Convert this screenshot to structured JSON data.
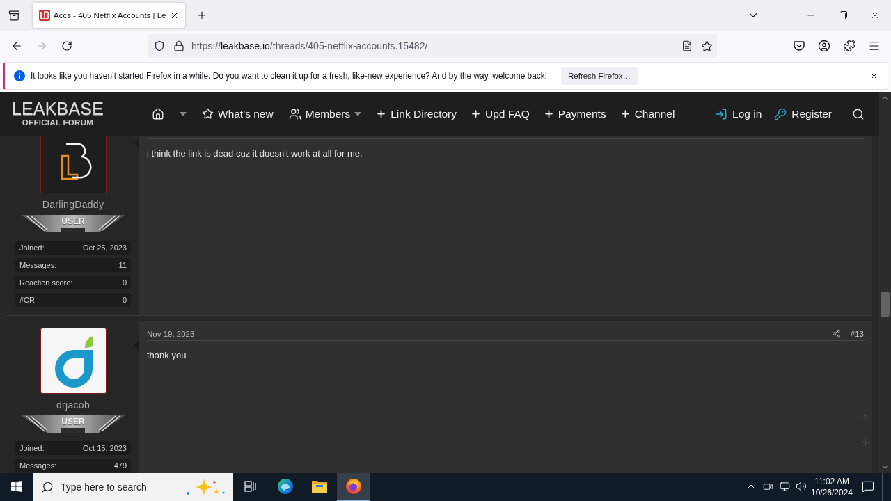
{
  "browser": {
    "tabs": [
      {
        "title": "Accs - 405 Netflix Accounts | Le",
        "selected": true
      }
    ],
    "toolbar": {
      "forward_disabled": true,
      "url": {
        "scheme": "https://",
        "domain": "leakbase.io",
        "path": "/threads/405-netflix-accounts.15482/"
      }
    },
    "notification": {
      "message": "It looks like you haven’t started Firefox in a while. Do you want to clean it up for a fresh, like-new experience? And by the way, welcome back!",
      "button": "Refresh Firefox…"
    }
  },
  "forum": {
    "logo": {
      "title": "LEAKBASE",
      "subtitle": "OFFICIAL FORUM"
    },
    "nav": [
      {
        "kind": "home",
        "dropdown": true
      },
      {
        "kind": "star",
        "label": "What's new",
        "dropdown": false
      },
      {
        "kind": "members",
        "label": "Members",
        "dropdown": true
      },
      {
        "kind": "plus",
        "label": "Link Directory",
        "dropdown": false
      },
      {
        "kind": "plus",
        "label": "Upd FAQ",
        "dropdown": false
      },
      {
        "kind": "plus",
        "label": "Payments",
        "dropdown": false
      },
      {
        "kind": "plus",
        "label": "Channel",
        "dropdown": false
      }
    ],
    "account": [
      {
        "kind": "login",
        "label": "Log in"
      },
      {
        "kind": "register",
        "label": "Register"
      }
    ]
  },
  "posts": [
    {
      "author": "DarlingDaddy",
      "avatar": {
        "kind": "lb-logo"
      },
      "rank": "USER",
      "stats": [
        {
          "label": "Joined:",
          "value": "Oct 25, 2023"
        },
        {
          "label": "Messages:",
          "value": "11"
        },
        {
          "label": "Reaction score:",
          "value": "0"
        },
        {
          "label": "#CR:",
          "value": "0"
        }
      ],
      "body": "i think the link is dead cuz it doesn't work at all for me."
    },
    {
      "author": "drjacob",
      "avatar": {
        "kind": "d-logo"
      },
      "rank": "USER",
      "stats": [
        {
          "label": "Joined:",
          "value": "Oct 15, 2023"
        },
        {
          "label": "Messages:",
          "value": "479"
        }
      ],
      "date": "Nov 19, 2023",
      "number": "#13",
      "body": "thank you"
    }
  ],
  "taskbar": {
    "search_placeholder": "Type here to search",
    "apps": [
      {
        "kind": "edge",
        "selected": false
      },
      {
        "kind": "explorer",
        "selected": false
      },
      {
        "kind": "firefox",
        "selected": true
      }
    ],
    "time": "11:02 AM",
    "date": "10/26/2024"
  }
}
